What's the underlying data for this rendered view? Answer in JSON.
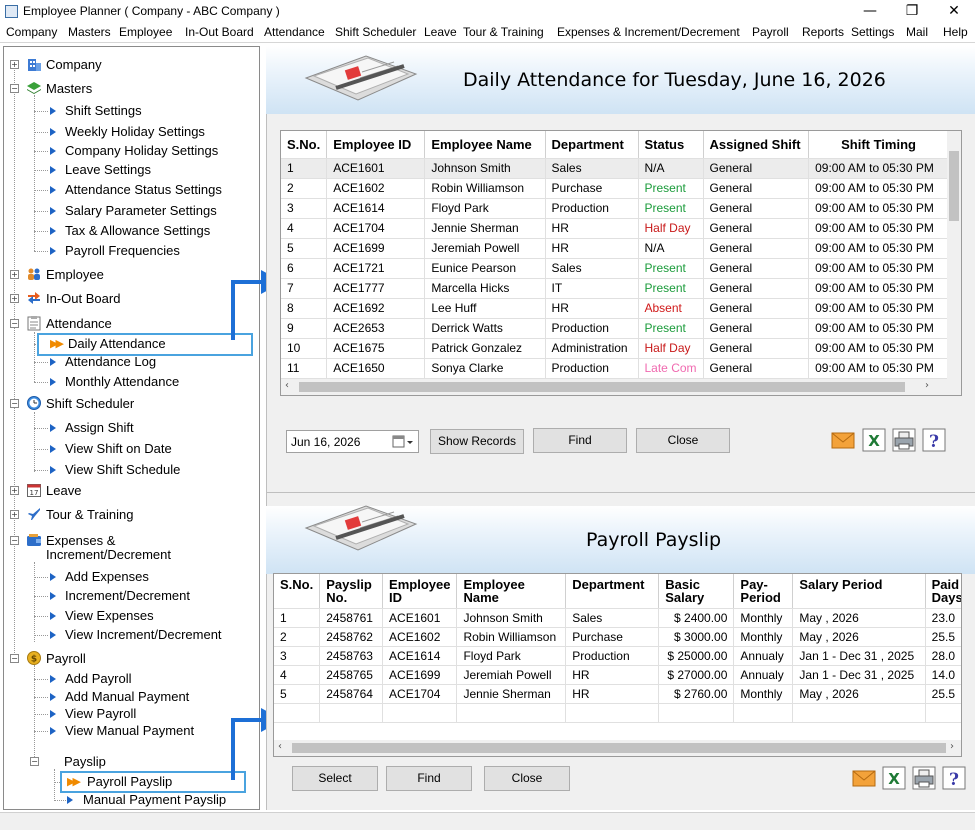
{
  "window": {
    "title": "Employee Planner ( Company - ABC Company )"
  },
  "menu": [
    "Company",
    "Masters",
    "Employee",
    "In-Out Board",
    "Attendance",
    "Shift Scheduler",
    "Leave",
    "Tour & Training",
    "Expenses & Increment/Decrement",
    "Payroll",
    "Reports",
    "Settings",
    "Mail",
    "Help"
  ],
  "tree": {
    "company": "Company",
    "masters": "Masters",
    "masters_items": [
      "Shift Settings",
      "Weekly Holiday Settings",
      "Company Holiday Settings",
      "Leave Settings",
      "Attendance Status Settings",
      "Salary Parameter Settings",
      "Tax & Allowance Settings",
      "Payroll Frequencies"
    ],
    "employee": "Employee",
    "inout": "In-Out Board",
    "attendance": "Attendance",
    "attendance_items": [
      "Daily Attendance",
      "Attendance Log",
      "Monthly Attendance"
    ],
    "shift": "Shift Scheduler",
    "shift_items": [
      "Assign Shift",
      "View Shift on Date",
      "View Shift Schedule"
    ],
    "leave": "Leave",
    "tour": "Tour & Training",
    "expenses_1": "Expenses &",
    "expenses_2": "Increment/Decrement",
    "expenses_items": [
      "Add Expenses",
      "Increment/Decrement",
      "View Expenses",
      "View Increment/Decrement"
    ],
    "payroll": "Payroll",
    "payroll_items": [
      "Add Payroll",
      "Add Manual Payment",
      "View Payroll",
      "View Manual Payment"
    ],
    "payslip": "Payslip",
    "payslip_items": [
      "Payroll Payslip",
      "Manual Payment Payslip"
    ]
  },
  "attendance": {
    "title": "Daily Attendance for Tuesday, June 16, 2026",
    "headers": [
      "S.No.",
      "Employee ID",
      "Employee Name",
      "Department",
      "Status",
      "Assigned Shift",
      "Shift Timing"
    ],
    "rows": [
      [
        "1",
        "ACE1601",
        "Johnson Smith",
        "Sales",
        "N/A",
        "General",
        "09:00 AM to 05:30 PM"
      ],
      [
        "2",
        "ACE1602",
        "Robin Williamson",
        "Purchase",
        "Present",
        "General",
        "09:00 AM to 05:30 PM"
      ],
      [
        "3",
        "ACE1614",
        "Floyd Park",
        "Production",
        "Present",
        "General",
        "09:00 AM to 05:30 PM"
      ],
      [
        "4",
        "ACE1704",
        "Jennie Sherman",
        "HR",
        "Half Day",
        "General",
        "09:00 AM to 05:30 PM"
      ],
      [
        "5",
        "ACE1699",
        "Jeremiah Powell",
        "HR",
        "N/A",
        "General",
        "09:00 AM to 05:30 PM"
      ],
      [
        "6",
        "ACE1721",
        "Eunice Pearson",
        "Sales",
        "Present",
        "General",
        "09:00 AM to 05:30 PM"
      ],
      [
        "7",
        "ACE1777",
        "Marcella Hicks",
        "IT",
        "Present",
        "General",
        "09:00 AM to 05:30 PM"
      ],
      [
        "8",
        "ACE1692",
        "Lee Huff",
        "HR",
        "Absent",
        "General",
        "09:00 AM to 05:30 PM"
      ],
      [
        "9",
        "ACE2653",
        "Derrick Watts",
        "Production",
        "Present",
        "General",
        "09:00 AM to 05:30 PM"
      ],
      [
        "10",
        "ACE1675",
        "Patrick Gonzalez",
        "Administration",
        "Half Day",
        "General",
        "09:00 AM to 05:30 PM"
      ],
      [
        "11",
        "ACE1650",
        "Sonya Clarke",
        "Production",
        "Late Com",
        "General",
        "09:00 AM to 05:30 PM"
      ]
    ],
    "date": "Jun  16, 2026",
    "buttons": {
      "show": "Show Records",
      "find": "Find",
      "close": "Close"
    }
  },
  "payslip": {
    "title": "Payroll Payslip",
    "headers": [
      [
        "S.No.",
        ""
      ],
      [
        "Payslip",
        "No."
      ],
      [
        "Employee",
        "ID"
      ],
      [
        "Employee",
        "Name"
      ],
      [
        "Department",
        ""
      ],
      [
        "Basic",
        "Salary"
      ],
      [
        "Pay-",
        "Period"
      ],
      [
        "Salary Period",
        ""
      ],
      [
        "Paid",
        "Days"
      ]
    ],
    "rows": [
      [
        "1",
        "2458761",
        "ACE1601",
        "Johnson Smith",
        "Sales",
        "$ 2400.00",
        "Monthly",
        "May , 2026",
        "23.0"
      ],
      [
        "2",
        "2458762",
        "ACE1602",
        "Robin Williamson",
        "Purchase",
        "$ 3000.00",
        "Monthly",
        "May , 2026",
        "25.5"
      ],
      [
        "3",
        "2458763",
        "ACE1614",
        "Floyd Park",
        "Production",
        "$ 25000.00",
        "Annualy",
        "Jan 1 - Dec 31 , 2025",
        "28.0"
      ],
      [
        "4",
        "2458765",
        "ACE1699",
        "Jeremiah Powell",
        "HR",
        "$ 27000.00",
        "Annualy",
        "Jan 1 - Dec 31 , 2025",
        "14.0"
      ],
      [
        "5",
        "2458764",
        "ACE1704",
        "Jennie Sherman",
        "HR",
        "$ 2760.00",
        "Monthly",
        "May , 2026",
        "25.5"
      ]
    ],
    "buttons": {
      "select": "Select",
      "find": "Find",
      "close": "Close"
    }
  }
}
